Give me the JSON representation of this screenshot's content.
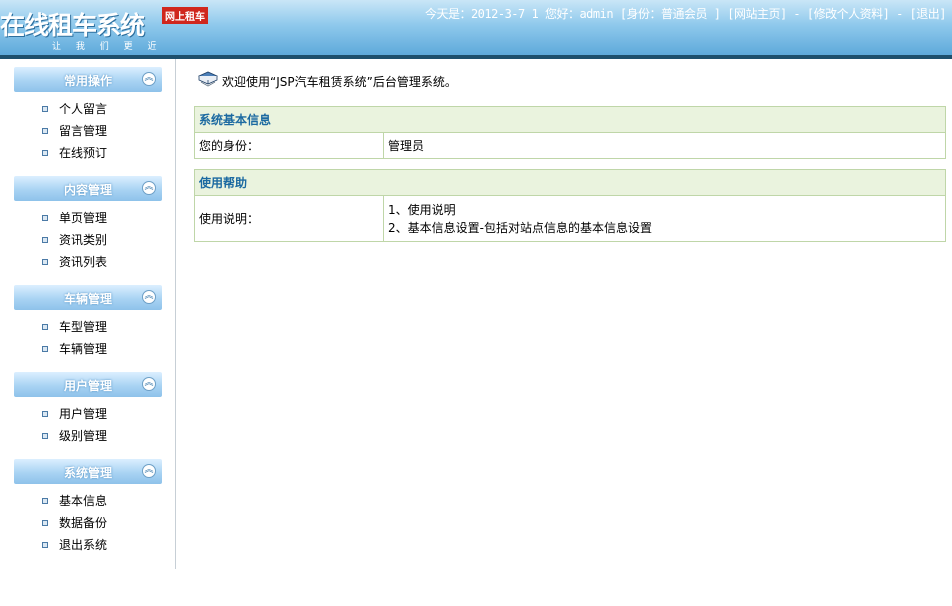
{
  "header": {
    "logo_text": "在线租车系统",
    "logo_badge": "网上租车",
    "slogan": "让 我 们 更 近",
    "today_label": "今天是：",
    "today_date": "2012-3-7 1",
    "hello_label": "您好：",
    "username": "admin",
    "role_label": "[身份：普通会员 ]",
    "home_link": "[网站主页]",
    "profile_link": "[修改个人资料]",
    "logout_link": "[退出]",
    "separator": "-"
  },
  "sidebar": {
    "groups": [
      {
        "title": "常用操作",
        "items": [
          "个人留言",
          "留言管理",
          "在线预订"
        ]
      },
      {
        "title": "内容管理",
        "items": [
          "单页管理",
          "资讯类别",
          "资讯列表"
        ]
      },
      {
        "title": "车辆管理",
        "items": [
          "车型管理",
          "车辆管理"
        ]
      },
      {
        "title": "用户管理",
        "items": [
          "用户管理",
          "级别管理"
        ]
      },
      {
        "title": "系统管理",
        "items": [
          "基本信息",
          "数据备份",
          "退出系统"
        ]
      }
    ],
    "collapse_glyph": "︽"
  },
  "main": {
    "welcome": "欢迎使用“JSP汽车租赁系统”后台管理系统。",
    "basic_info": {
      "heading": "系统基本信息",
      "label": "您的身份：",
      "value": "管理员"
    },
    "help": {
      "heading": "使用帮助",
      "label": "使用说明：",
      "lines": [
        "1、使用说明",
        "2、基本信息设置-包括对站点信息的基本信息设置"
      ]
    }
  },
  "colors": {
    "header_blue": "#5ea9da",
    "section_heading_text": "#1c6aa1",
    "section_heading_bg": "#eaf3de",
    "table_border": "#bfd6a8",
    "badge_red": "#d0271d"
  }
}
